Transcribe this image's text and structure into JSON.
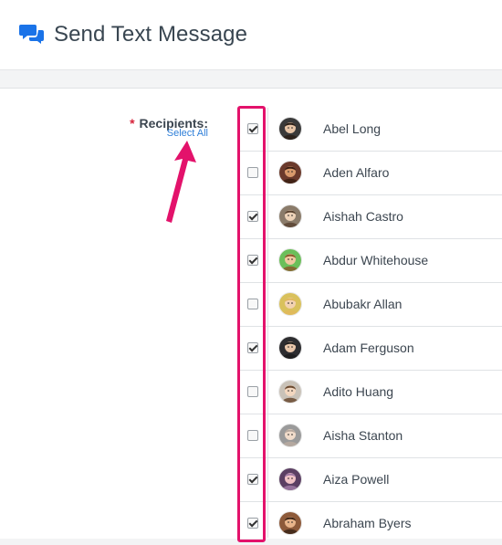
{
  "header": {
    "title": "Send Text Message",
    "icon": "chat-bubbles-icon",
    "icon_color": "#1a73e8"
  },
  "form": {
    "required_mark": "*",
    "recipients_label": "Recipients:",
    "select_all_label": "Select All"
  },
  "annotation": {
    "color": "#e3126b",
    "arrow": "pointer-arrow-icon"
  },
  "recipients": [
    {
      "name": "Abel Long",
      "checked": true,
      "avatar": {
        "bg": "#3a3a3a",
        "skin": "#e6c3a5",
        "hair": "#2a1f18"
      }
    },
    {
      "name": "Aden Alfaro",
      "checked": false,
      "avatar": {
        "bg": "#6b3a2c",
        "skin": "#d99a6c",
        "hair": "#3a1e12"
      }
    },
    {
      "name": "Aishah Castro",
      "checked": true,
      "avatar": {
        "bg": "#8a7b6a",
        "skin": "#edd2b8",
        "hair": "#5b4432"
      }
    },
    {
      "name": "Abdur Whitehouse",
      "checked": true,
      "avatar": {
        "bg": "#6bbf5a",
        "skin": "#f0c9a0",
        "hair": "#8a5a2b"
      }
    },
    {
      "name": "Abubakr Allan",
      "checked": false,
      "avatar": {
        "bg": "#d9c15c",
        "skin": "#f2d2b0",
        "hair": "#e0b85a"
      }
    },
    {
      "name": "Adam Ferguson",
      "checked": true,
      "avatar": {
        "bg": "#2d2d30",
        "skin": "#e8c6aa",
        "hair": "#1c1c1c"
      }
    },
    {
      "name": "Adito Huang",
      "checked": false,
      "avatar": {
        "bg": "#c9c2b8",
        "skin": "#f3d7bf",
        "hair": "#6a4a30"
      }
    },
    {
      "name": "Aisha Stanton",
      "checked": false,
      "avatar": {
        "bg": "#9a9a9a",
        "skin": "#f1dccb",
        "hair": "#b8aaa0"
      }
    },
    {
      "name": "Aiza Powell",
      "checked": true,
      "avatar": {
        "bg": "#5b3f63",
        "skin": "#f0c2c6",
        "hair": "#a07aa5"
      }
    },
    {
      "name": "Abraham Byers",
      "checked": true,
      "avatar": {
        "bg": "#8d5a3a",
        "skin": "#e8b48a",
        "hair": "#3b2416"
      }
    }
  ]
}
